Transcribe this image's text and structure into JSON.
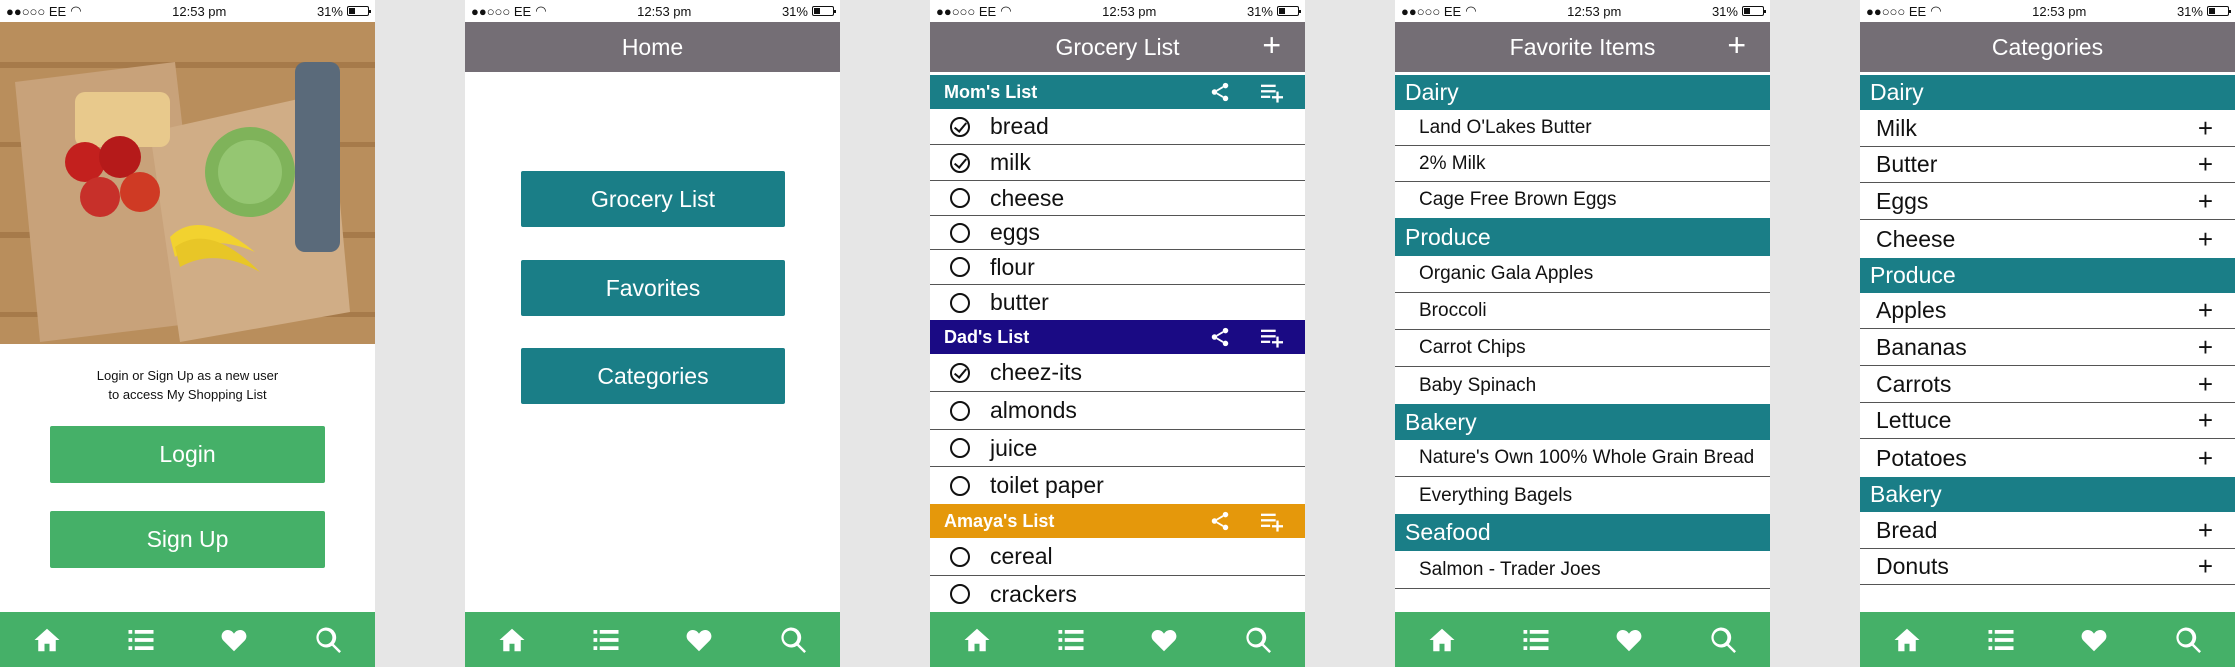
{
  "status": {
    "carrier": "●●○○○ EE",
    "time": "12:53 pm",
    "battery": "31%"
  },
  "colors": {
    "title_bar": "#746e75",
    "green": "#45b068",
    "teal": "#1a7e87",
    "navy": "#1a0a84",
    "orange": "#e5980b"
  },
  "login_screen": {
    "intro_line1": "Login or Sign Up as a new user",
    "intro_line2": "to access My Shopping List",
    "login_label": "Login",
    "signup_label": "Sign Up"
  },
  "home_screen": {
    "title": "Home",
    "buttons": [
      "Grocery List",
      "Favorites",
      "Categories"
    ]
  },
  "grocery_screen": {
    "title": "Grocery List",
    "add_icon": "+",
    "lists": [
      {
        "name": "Mom's List",
        "color": "#1a7e87",
        "items": [
          {
            "label": "bread",
            "checked": true
          },
          {
            "label": "milk",
            "checked": true
          },
          {
            "label": "cheese",
            "checked": false
          },
          {
            "label": "eggs",
            "checked": false
          },
          {
            "label": "flour",
            "checked": false
          },
          {
            "label": "butter",
            "checked": false
          }
        ]
      },
      {
        "name": "Dad's List",
        "color": "#1a0a84",
        "items": [
          {
            "label": "cheez-its",
            "checked": true
          },
          {
            "label": "almonds",
            "checked": false
          },
          {
            "label": "juice",
            "checked": false
          },
          {
            "label": "toilet paper",
            "checked": false
          }
        ]
      },
      {
        "name": "Amaya's List",
        "color": "#e5980b",
        "items": [
          {
            "label": "cereal",
            "checked": false
          },
          {
            "label": "crackers",
            "checked": false
          }
        ]
      }
    ]
  },
  "favorites_screen": {
    "title": "Favorite Items",
    "add_icon": "+",
    "sections": [
      {
        "name": "Dairy",
        "items": [
          "Land O'Lakes Butter",
          "2% Milk",
          "Cage Free Brown Eggs"
        ]
      },
      {
        "name": "Produce",
        "items": [
          "Organic Gala Apples",
          "Broccoli",
          "Carrot Chips",
          "Baby Spinach"
        ]
      },
      {
        "name": "Bakery",
        "items": [
          "Nature's Own 100% Whole Grain Bread",
          "Everything Bagels"
        ]
      },
      {
        "name": "Seafood",
        "items": [
          "Salmon - Trader Joes"
        ]
      }
    ]
  },
  "categories_screen": {
    "title": "Categories",
    "add_icon": "+",
    "sections": [
      {
        "name": "Dairy",
        "items": [
          "Milk",
          "Butter",
          "Eggs",
          "Cheese"
        ]
      },
      {
        "name": "Produce",
        "items": [
          "Apples",
          "Bananas",
          "Carrots",
          "Lettuce",
          "Potatoes"
        ]
      },
      {
        "name": "Bakery",
        "items": [
          "Bread",
          "Donuts"
        ]
      }
    ]
  },
  "tabbar_icons": [
    "home-icon",
    "list-icon",
    "heart-icon",
    "search-icon"
  ]
}
